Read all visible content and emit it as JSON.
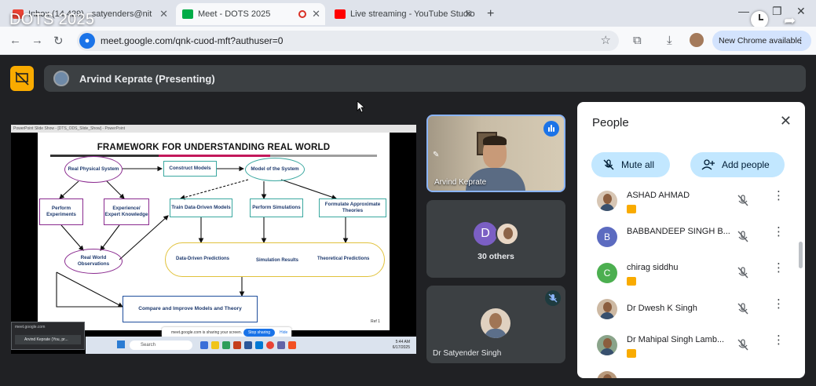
{
  "overlay_title": "DOTS 2025",
  "tabs": [
    {
      "label": "Inbox (14,429) - satyenders@nit",
      "favicon_color": "#ea4335"
    },
    {
      "label": "Meet - DOTS 2025",
      "favicon_color": "#00ac47"
    },
    {
      "label": "Live streaming - YouTube Studio",
      "favicon_color": "#ff0000"
    }
  ],
  "toolbar": {
    "url": "meet.google.com/qnk-cuod-mft?authuser=0",
    "new_chrome": "New Chrome available"
  },
  "presenting": {
    "name": "Arvind Keprate (Presenting)"
  },
  "shared_screen": {
    "window_bar": "PowerPoint Slide Show - [DTS_ODS_Slide_Show] - PowerPoint",
    "mini_window_url": "meet.google.com",
    "mini_window_row": "Arvind Keprate (You, pr...",
    "sharing_text": "meet.google.com is sharing your screen.",
    "stop_sharing": "Stop sharing",
    "hide": "Hide",
    "taskbar_search": "Search",
    "taskbar_clock_time": "5:44 AM",
    "taskbar_clock_date": "6/17/2025",
    "slide": {
      "title": "FRAMEWORK FOR UNDERSTANDING REAL WORLD",
      "nodes": {
        "real_physical_system": "Real Physical System",
        "construct_models": "Construct Models",
        "model_of_system": "Model of the System",
        "perform_experiments": "Perform Experiments",
        "experience_knowledge": "Experience/ Expert Knowledge",
        "train_models": "Train Data-Driven Models",
        "perform_simulations": "Perform Simulations",
        "formulate_theories": "Formulate Approximate Theories",
        "real_world_observations": "Real World Observations",
        "data_driven_predictions": "Data-Driven Predictions",
        "simulation_results": "Simulation Results",
        "theoretical_predictions": "Theoretical Predictions",
        "compare_improve": "Compare and Improve Models and Theory"
      },
      "reference": "Ref 1"
    }
  },
  "tiles": {
    "speaker_label": "Arvind Keprate",
    "others_label": "30 others",
    "others_avatar_letter": "D",
    "self_label": "Dr Satyender Singh"
  },
  "people_panel": {
    "title": "People",
    "mute_all": "Mute all",
    "add_people": "Add people",
    "participants": [
      {
        "name": "ASHAD AHMAD",
        "avatar": "photo",
        "badge": true
      },
      {
        "name": "BABBANDEEP SINGH B...",
        "avatar": "B",
        "color": "#5c6bc0",
        "badge": false
      },
      {
        "name": "chirag siddhu",
        "avatar": "C",
        "color": "#4caf50",
        "badge": true
      },
      {
        "name": "Dr Dwesh K Singh",
        "avatar": "photo",
        "badge": false
      },
      {
        "name": "Dr Mahipal Singh Lamb...",
        "avatar": "photo",
        "badge": true
      }
    ]
  }
}
